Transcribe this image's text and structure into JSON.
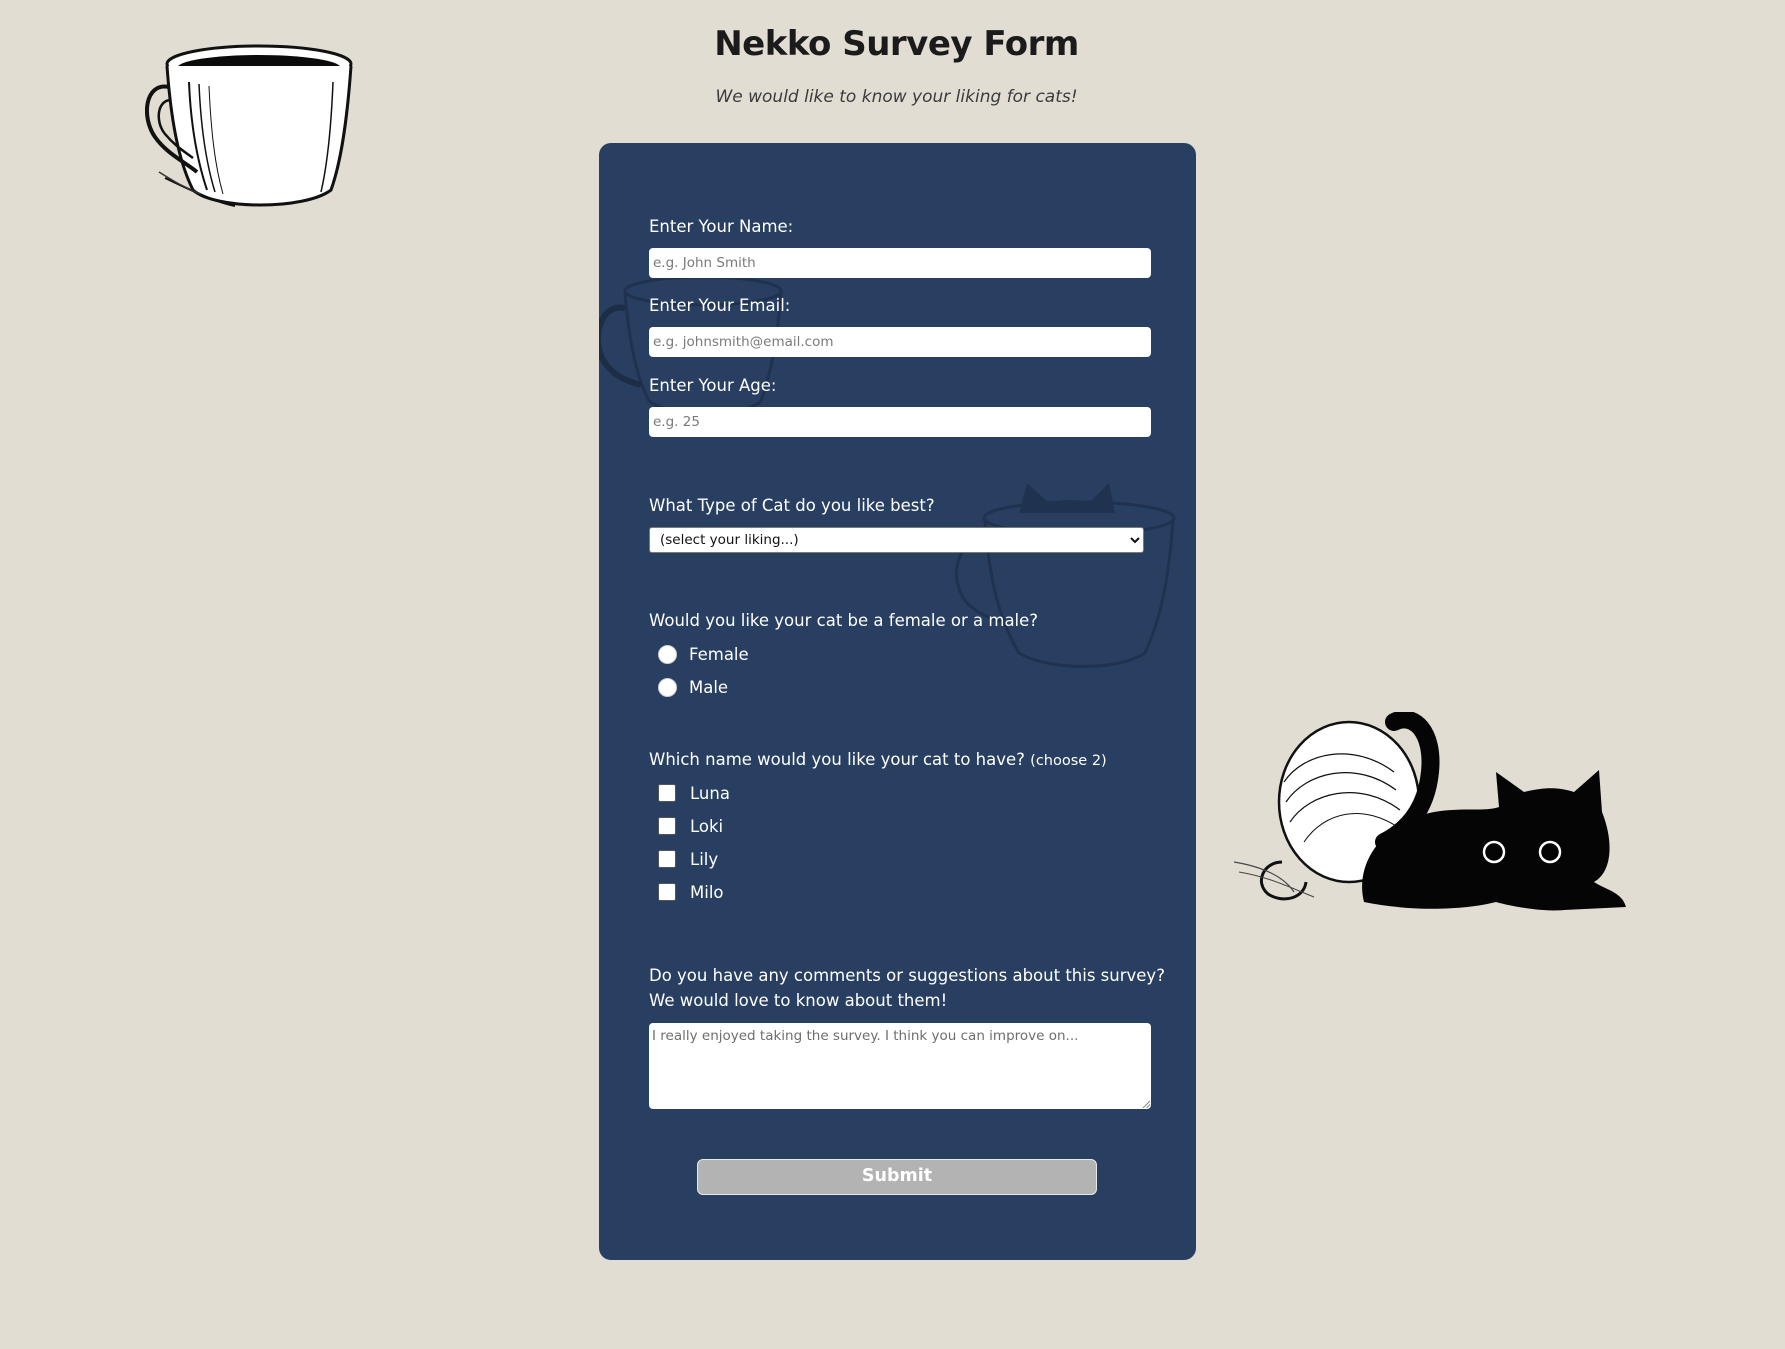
{
  "header": {
    "title": "Nekko Survey Form",
    "subtitle": "We would like to know your liking for cats!"
  },
  "form": {
    "name": {
      "label": "Enter Your Name:",
      "placeholder": "e.g. John Smith",
      "value": ""
    },
    "email": {
      "label": "Enter Your Email:",
      "placeholder": "e.g. johnsmith@email.com",
      "value": ""
    },
    "age": {
      "label": "Enter Your Age:",
      "placeholder": "e.g. 25",
      "value": ""
    },
    "cat_type": {
      "label": "What Type of Cat do you like best?",
      "selected": "(select your liking...)"
    },
    "gender": {
      "label": "Would you like your cat be a female or a male?",
      "options": [
        "Female",
        "Male"
      ],
      "selected": null
    },
    "names": {
      "label": "Which name would you like your cat to have?",
      "hint": "(choose 2)",
      "options": [
        "Luna",
        "Loki",
        "Lily",
        "Milo"
      ],
      "checked": []
    },
    "comments": {
      "label_line1": "Do you have any comments or suggestions about this survey?",
      "label_line2": "We would love to know about them!",
      "placeholder": "I really enjoyed taking the survey. I think you can improve on...",
      "value": ""
    },
    "submit_label": "Submit"
  },
  "icons": {
    "top_left": "coffee-cup-icon",
    "bottom_right": "black-cat-in-tipped-cup-icon",
    "card_watermark_1": "coffee-cup-icon",
    "card_watermark_2": "cat-in-cup-icon"
  },
  "colors": {
    "background": "#e1ddd2",
    "card": "#283f61",
    "submit": "#b3b3b3"
  }
}
